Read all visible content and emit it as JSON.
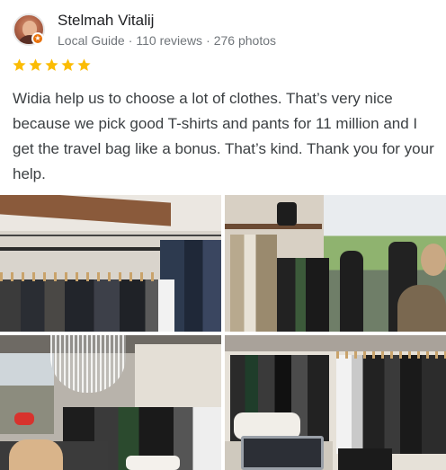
{
  "author": {
    "name": "Stelmah Vitalij",
    "level": "Local Guide",
    "separator": "·",
    "reviews": "110 reviews",
    "photos": "276 photos"
  },
  "rating": {
    "stars": 5,
    "max": 5,
    "star_color": "#fbbc04"
  },
  "review": {
    "text": "Widia help us to choose a lot of clothes. That’s very nice because we pick good T-shirts and pants for 11 million and I get the travel bag like a bonus. That’s kind. Thank you for your help."
  },
  "colors": {
    "badge": "#e8710a",
    "meta": "#70757a",
    "text": "#3c4043"
  },
  "photos": [
    {
      "name": "clothing-rack-photo"
    },
    {
      "name": "store-entrance-photo"
    },
    {
      "name": "chandelier-rack-photo"
    },
    {
      "name": "store-interior-photo"
    }
  ]
}
